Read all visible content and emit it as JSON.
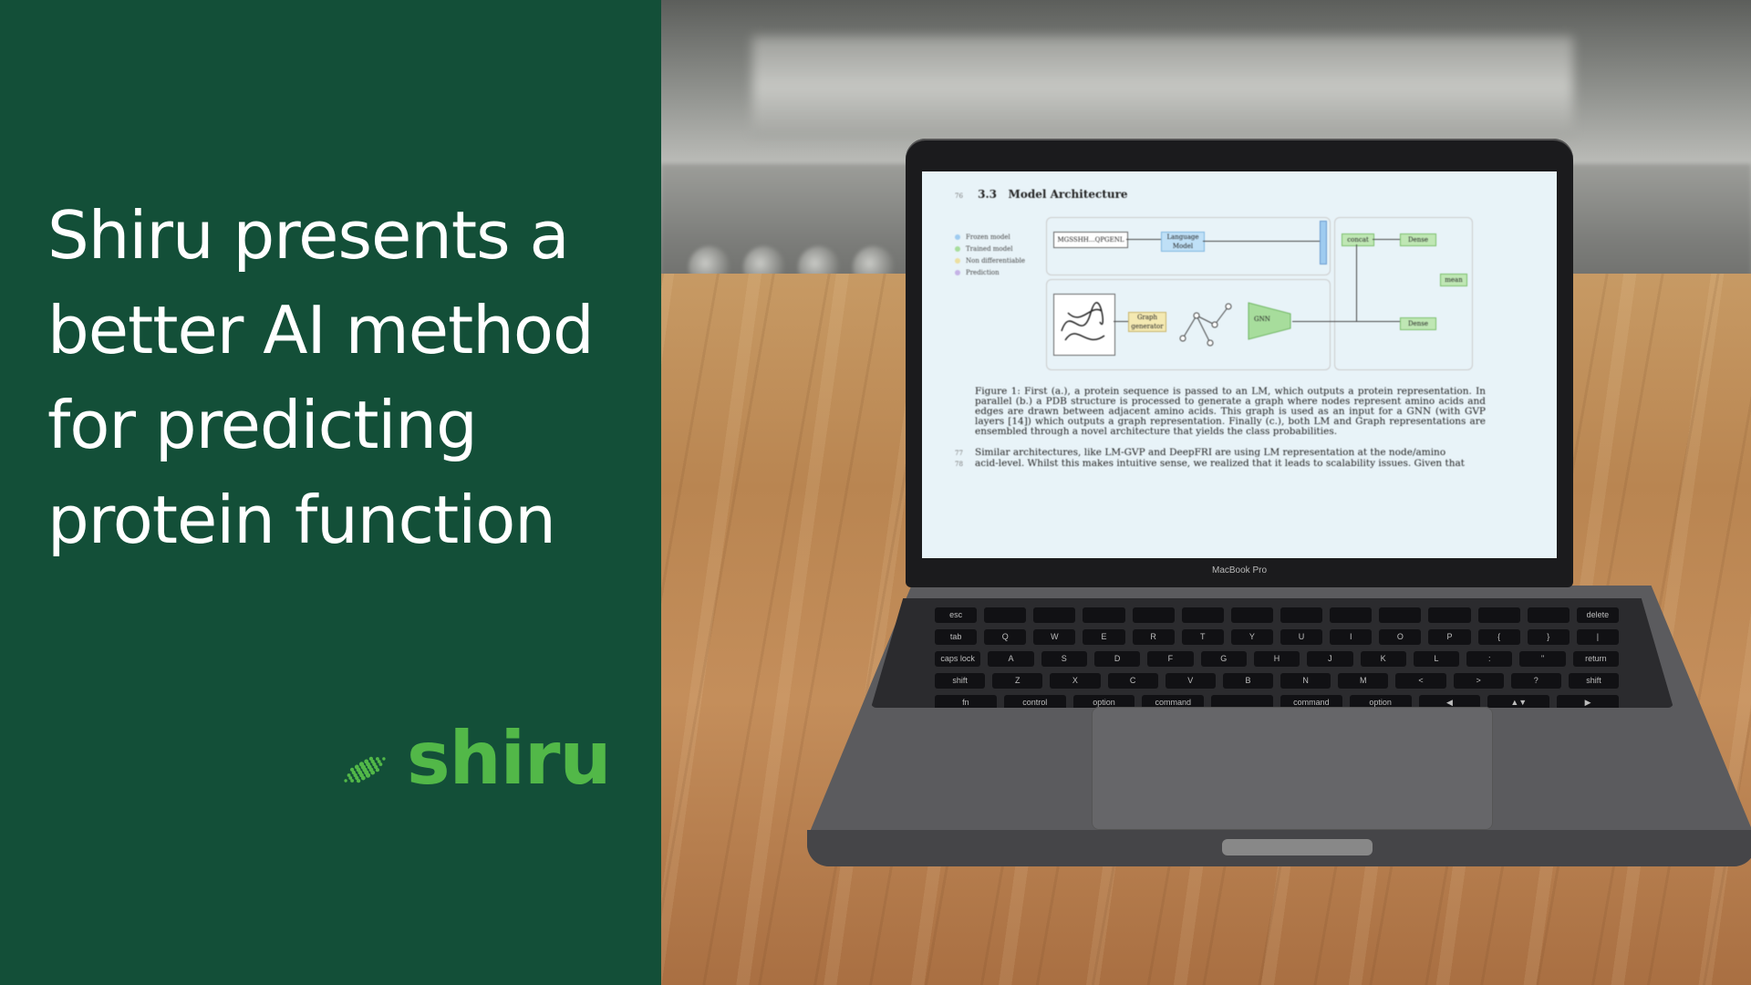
{
  "headline": {
    "lines": [
      "Shiru presents a",
      "better AI method",
      "for predicting",
      "protein function"
    ]
  },
  "brand": {
    "wordmark": "shiru",
    "logo_icon": "dotted-leaf-icon",
    "accent_color": "#52b848",
    "panel_color": "#134f38"
  },
  "laptop": {
    "label": "MacBook Pro",
    "screen": {
      "section_number": "3.3",
      "section_title": "Model Architecture",
      "line_number_heading": "76",
      "legend": [
        "Frozen model",
        "Trained model",
        "Non differentiable",
        "Prediction"
      ],
      "diagram_labels": {
        "sequence": "MGSSHH...QPGENL",
        "language_model": "Language Model",
        "graph_generator": "Graph generator",
        "gnn": "GNN",
        "concat": "concat",
        "dense_top": "Dense",
        "dense_bottom": "Dense",
        "mean": "mean"
      },
      "caption": "Figure 1: First (a.), a protein sequence is passed to an LM, which outputs a protein representation. In parallel (b.) a PDB structure is processed to generate a graph where nodes represent amino acids and edges are drawn between adjacent amino acids. This graph is used as an input for a GNN (with GVP layers [14]) which outputs a graph representation. Finally (c.), both LM and Graph representations are ensembled through a novel architecture that yields the class probabilities.",
      "body_lines": [
        {
          "num": "77",
          "text": "Similar architectures, like LM-GVP and DeepFRI are using LM representation at the node/amino"
        },
        {
          "num": "78",
          "text": "acid-level. Whilst this makes intuitive sense, we realized that it leads to scalability issues. Given that"
        }
      ]
    },
    "keyboard_rows": [
      [
        "esc",
        "",
        "",
        "",
        "",
        "",
        "",
        "",
        "",
        "",
        "",
        "",
        "",
        "delete"
      ],
      [
        "tab",
        "Q",
        "W",
        "E",
        "R",
        "T",
        "Y",
        "U",
        "I",
        "O",
        "P",
        "{",
        "}",
        "|"
      ],
      [
        "caps lock",
        "A",
        "S",
        "D",
        "F",
        "G",
        "H",
        "J",
        "K",
        "L",
        ":",
        "\"",
        "return"
      ],
      [
        "shift",
        "Z",
        "X",
        "C",
        "V",
        "B",
        "N",
        "M",
        "<",
        ">",
        "?",
        "shift"
      ],
      [
        "fn",
        "control",
        "option",
        "command",
        "",
        "command",
        "option",
        "◀",
        "▲▼",
        "▶"
      ]
    ]
  }
}
